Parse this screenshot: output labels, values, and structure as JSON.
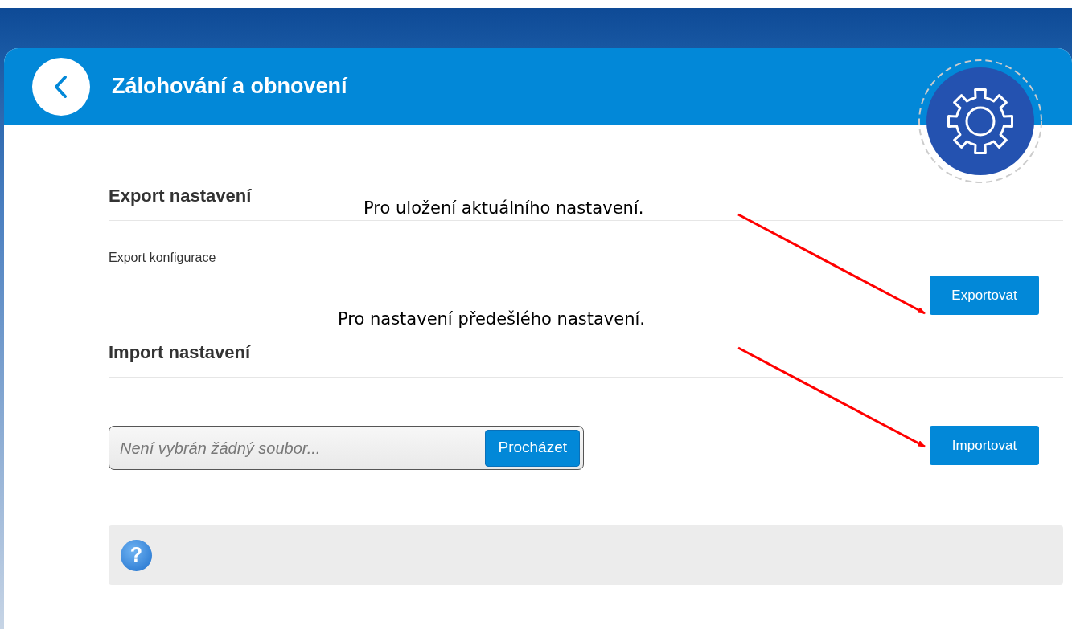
{
  "header": {
    "title": "Zálohování a obnovení"
  },
  "sections": [
    {
      "heading": "Export nastavení",
      "rows": [
        {
          "label": "Export konfigurace",
          "button": "Exportovat"
        }
      ]
    },
    {
      "heading": "Import nastavení",
      "rows": [
        {
          "file_placeholder": "Není vybrán žádný soubor...",
          "browse_button": "Procházet",
          "button": "Importovat"
        }
      ]
    }
  ],
  "help": {
    "icon": "?"
  },
  "annotations": [
    {
      "text": "Pro uložení aktuálního nastavení."
    },
    {
      "text": "Pro nastavení předešlého nastavení."
    }
  ]
}
